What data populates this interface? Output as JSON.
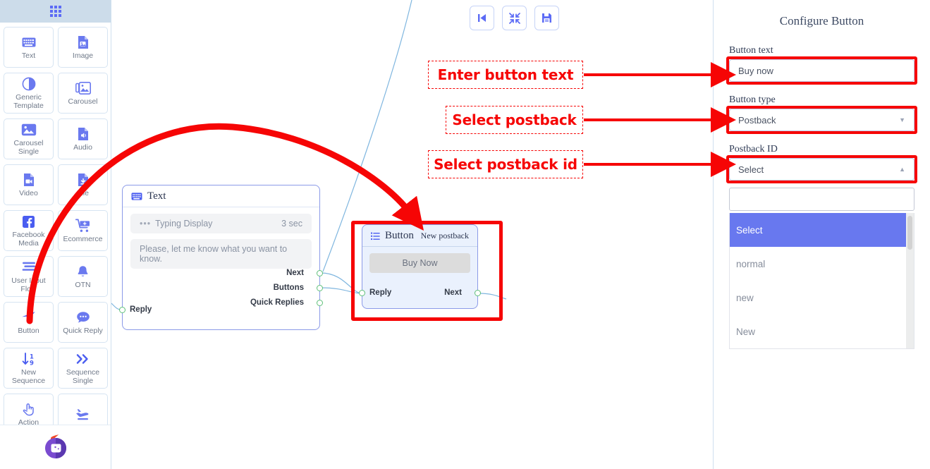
{
  "sidebar": {
    "header_icon": "grid-apps-icon",
    "items": [
      {
        "label": "Text",
        "icon": "keyboard-icon"
      },
      {
        "label": "Image",
        "icon": "image-file-icon"
      },
      {
        "label": "Generic Template",
        "icon": "contrast-circle-icon"
      },
      {
        "label": "Carousel",
        "icon": "carousel-images-icon"
      },
      {
        "label": "Carousel Single",
        "icon": "single-image-icon"
      },
      {
        "label": "Audio",
        "icon": "audio-file-icon"
      },
      {
        "label": "Video",
        "icon": "video-file-icon"
      },
      {
        "label": "File",
        "icon": "download-file-icon"
      },
      {
        "label": "Facebook Media",
        "icon": "facebook-icon"
      },
      {
        "label": "Ecommerce",
        "icon": "shopping-cart-icon"
      },
      {
        "label": "User Input Flow",
        "icon": "lines-flow-icon"
      },
      {
        "label": "OTN",
        "icon": "bell-icon"
      },
      {
        "label": "Button",
        "icon": "cursor-arrow-icon"
      },
      {
        "label": "Quick Reply",
        "icon": "chat-bubble-icon"
      },
      {
        "label": "New Sequence",
        "icon": "sort-numeric-icon"
      },
      {
        "label": "Sequence Single",
        "icon": "double-chevron-right-icon"
      },
      {
        "label": "Action",
        "icon": "hand-click-icon"
      },
      {
        "label": "",
        "icon": "plane-takeoff-icon"
      }
    ],
    "logo": "flame-bot-logo"
  },
  "canvas": {
    "toolbar": [
      {
        "name": "step-back-button",
        "icon": "skip-back-icon"
      },
      {
        "name": "fit-view-button",
        "icon": "collapse-arrows-icon"
      },
      {
        "name": "save-button",
        "icon": "floppy-save-icon"
      }
    ],
    "text_node": {
      "title": "Text",
      "icon": "keyboard-icon",
      "typing_label": "Typing Display",
      "typing_value": "3 sec",
      "message": "Please, let me know what you want to know.",
      "ports_right": [
        "Next",
        "Buttons",
        "Quick Replies"
      ],
      "port_left": "Reply"
    },
    "button_node": {
      "title": "Button",
      "icon": "list-icon",
      "badge": "New postback",
      "button_label": "Buy Now",
      "port_left": "Reply",
      "port_right": "Next"
    }
  },
  "annotations": [
    {
      "text": "Enter button text"
    },
    {
      "text": "Select postback"
    },
    {
      "text": "Select postback id"
    }
  ],
  "panel": {
    "title": "Configure Button",
    "button_text_label": "Button text",
    "button_text_value": "Buy now",
    "button_type_label": "Button type",
    "button_type_value": "Postback",
    "postback_id_label": "Postback ID",
    "postback_id_value": "Select",
    "search_value": "",
    "options": [
      "Select",
      "normal",
      "new",
      "New"
    ],
    "selected_option": "Select"
  },
  "colors": {
    "accent": "#5c6bf5",
    "annotation_red": "#f60505",
    "dropdown_selected": "#6878ef",
    "sidebar_header": "#ccdcea",
    "node_border": "#8b9ae8",
    "port_green": "#5fc07a"
  }
}
